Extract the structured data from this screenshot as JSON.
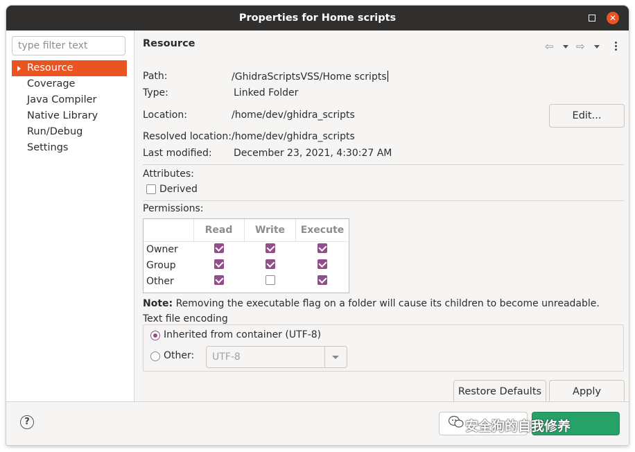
{
  "window": {
    "title": "Properties for Home scripts"
  },
  "sidebar": {
    "filter_placeholder": "type filter text",
    "items": [
      {
        "label": "Resource",
        "selected": true
      },
      {
        "label": "Coverage"
      },
      {
        "label": "Java Compiler"
      },
      {
        "label": "Native Library"
      },
      {
        "label": "Run/Debug Settings"
      }
    ]
  },
  "page": {
    "title": "Resource",
    "path_label": "Path:",
    "path_value": "/GhidraScriptsVSS/Home scripts",
    "type_label": "Type:",
    "type_value": "Linked Folder",
    "location_label": "Location:",
    "location_value": "/home/dev/ghidra_scripts",
    "edit_button": "Edit...",
    "resolved_label": "Resolved location:",
    "resolved_value": "/home/dev/ghidra_scripts",
    "modified_label": "Last modified:",
    "modified_value": "December 23, 2021, 4:30:27 AM",
    "attributes_label": "Attributes:",
    "derived_label": "Derived",
    "derived_checked": false,
    "permissions_label": "Permissions:",
    "permissions": {
      "columns": [
        "Read",
        "Write",
        "Execute"
      ],
      "rows": [
        {
          "label": "Owner",
          "values": [
            true,
            true,
            true
          ]
        },
        {
          "label": "Group",
          "values": [
            true,
            true,
            true
          ]
        },
        {
          "label": "Other",
          "values": [
            true,
            false,
            true
          ]
        }
      ]
    },
    "note_bold": "Note:",
    "note_text": " Removing the executable flag on a folder will cause its children to become unreadable.",
    "encoding": {
      "group_label": "Text file encoding",
      "inherited_label": "Inherited from container (UTF-8)",
      "inherited_selected": true,
      "other_label": "Other:",
      "other_value": "UTF-8"
    },
    "restore_button": "Restore Defaults",
    "apply_button": "Apply"
  },
  "footer": {
    "help_icon": "?",
    "watermark_text": "安全狗的自我修养"
  },
  "colors": {
    "accent": "#e95420",
    "check": "#924d8b",
    "apply_close": "#26a269",
    "titlebar": "#302f2e"
  }
}
